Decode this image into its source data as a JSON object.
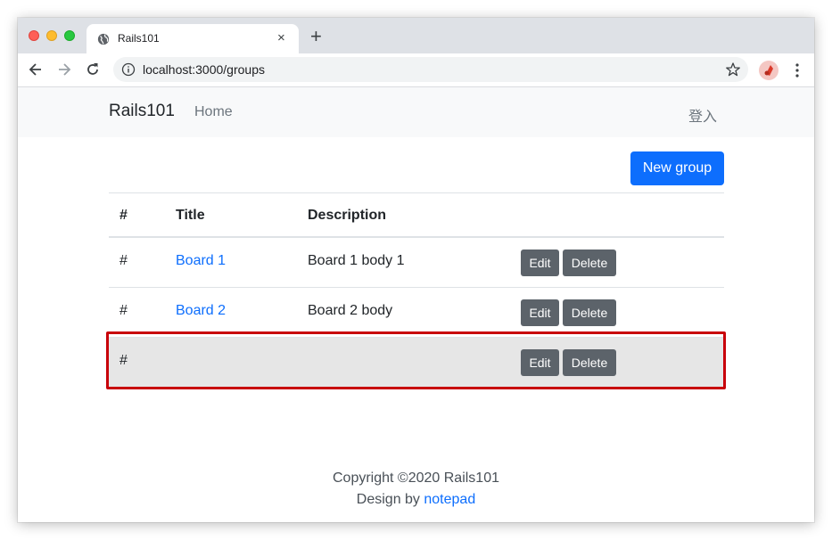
{
  "browser": {
    "tab_title": "Rails101",
    "tab_close_glyph": "×",
    "new_tab_glyph": "+",
    "url": "localhost:3000/groups"
  },
  "navbar": {
    "brand": "Rails101",
    "home": "Home",
    "login": "登入"
  },
  "actions": {
    "new_group": "New group"
  },
  "table": {
    "headers": [
      "#",
      "Title",
      "Description"
    ],
    "rows": [
      {
        "id": "#",
        "title": "Board 1",
        "description": "Board 1 body 1",
        "edit": "Edit",
        "delete": "Delete"
      },
      {
        "id": "#",
        "title": "Board 2",
        "description": "Board 2 body",
        "edit": "Edit",
        "delete": "Delete"
      },
      {
        "id": "#",
        "title": "",
        "description": "",
        "edit": "Edit",
        "delete": "Delete"
      }
    ]
  },
  "footer": {
    "copyright": "Copyright ©2020 Rails101",
    "design_prefix": "Design by ",
    "design_link": "notepad"
  },
  "colors": {
    "primary": "#0d6efd",
    "secondary_button": "#5c636a",
    "highlight_border": "#c8000a"
  }
}
